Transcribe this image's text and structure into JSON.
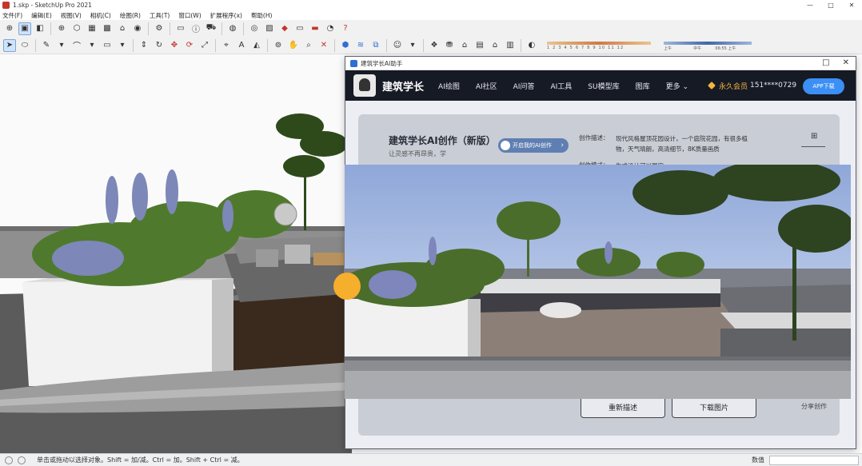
{
  "window": {
    "title": "1.skp - SketchUp Pro 2021",
    "controls": [
      "—",
      "□",
      "✕"
    ]
  },
  "menu": [
    "文件(F)",
    "编辑(E)",
    "视图(V)",
    "相机(C)",
    "绘图(R)",
    "工具(T)",
    "窗口(W)",
    "扩展程序(x)",
    "帮助(H)"
  ],
  "toolbar1_icons": [
    "add-location-icon",
    "warehouse-icon",
    "component-icon",
    "style-icon",
    "user-icon",
    "gear-icon",
    "box-icon",
    "info-icon",
    "cart-icon",
    "profile-icon",
    "globe-icon",
    "photo-icon",
    "ruby-icon",
    "screen-icon",
    "book-icon",
    "extension-icon",
    "help-icon"
  ],
  "shadow_settings": {
    "months": "1 2 3 4 5 6 7 8 9 10 11 12",
    "time_left": "上午",
    "time_right": "中午",
    "time_end": "06:55 上午"
  },
  "plugin": {
    "window_title": "建筑学长AI助手",
    "brand": "建筑学长",
    "nav": [
      "AI绘图",
      "AI社区",
      "AI问答",
      "AI工具",
      "SU模型库",
      "图库",
      "更多 ⌄"
    ],
    "vip": "永久会员",
    "phone": "151****0729",
    "app_button": "APP下载",
    "card_title": "建筑学长AI创作（新版）",
    "card_subtitle": "让灵感不再昂贵，学",
    "pill_label": "开启我的AI创作",
    "desc_label": "创作描述：",
    "desc_text": "现代风格屋顶花园设计，一个庭院花园，有很多植物，天气晴朗，高清细节，8K质量画质",
    "desc_label2": "创作模式：",
    "desc_text2": "生成设计可以写实",
    "btn_redesc": "重新描述",
    "btn_download": "下载图片",
    "share": "分享创作"
  },
  "status": {
    "hint": "单击或拖动以选择对象。Shift = 加/减。Ctrl = 加。Shift + Ctrl = 减。",
    "measure_label": "数值"
  },
  "colors": {
    "nav_bg": "#161a24",
    "accent": "#3b8ff5",
    "vip": "#f5b53d",
    "handle": "#f6ae2d"
  }
}
